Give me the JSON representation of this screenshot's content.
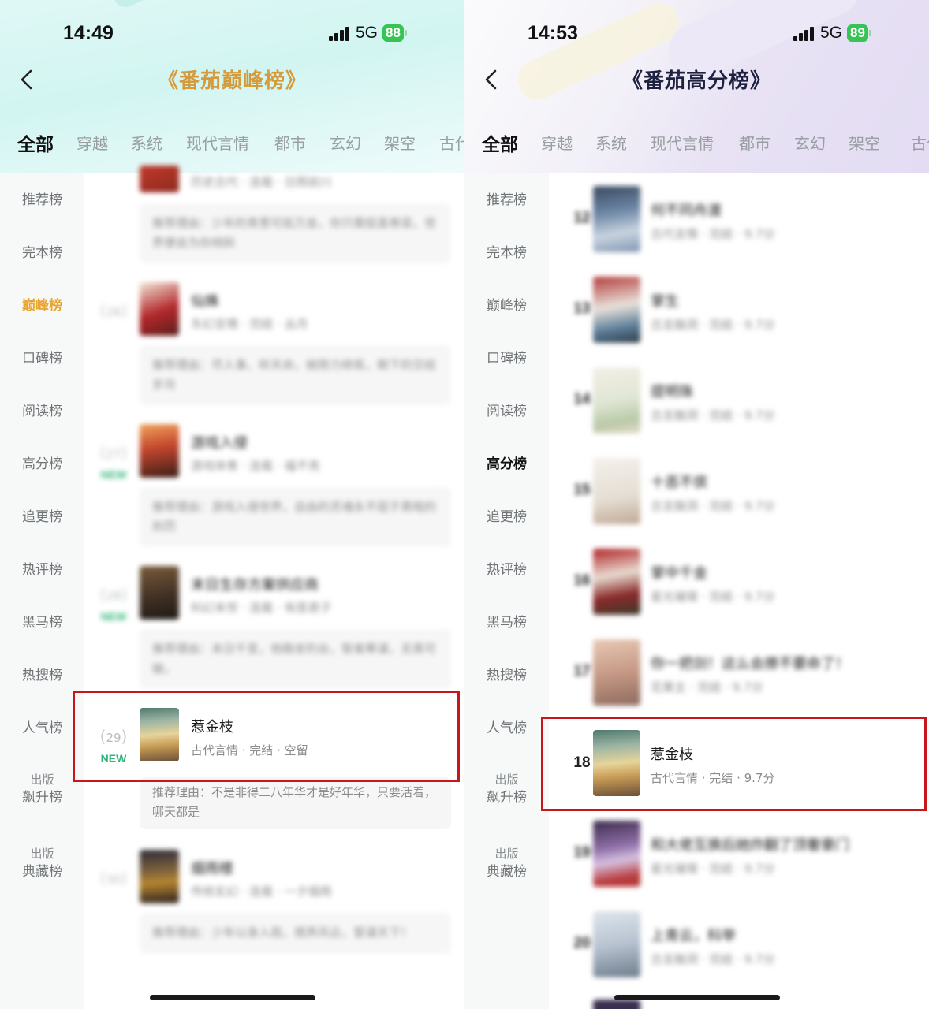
{
  "left": {
    "status": {
      "time": "14:49",
      "network": "5G",
      "battery": "88"
    },
    "nav": {
      "title": "《番茄巅峰榜》"
    },
    "tabs": [
      "全部",
      "穿越",
      "系统",
      "现代言情",
      "都市",
      "玄幻",
      "架空",
      "古代"
    ],
    "sidebar": [
      {
        "label": "推荐榜"
      },
      {
        "label": "完本榜"
      },
      {
        "label": "巅峰榜",
        "active": true
      },
      {
        "label": "口碑榜"
      },
      {
        "label": "阅读榜"
      },
      {
        "label": "高分榜"
      },
      {
        "label": "追更榜"
      },
      {
        "label": "热评榜"
      },
      {
        "label": "黑马榜"
      },
      {
        "label": "热搜榜"
      },
      {
        "label": "人气榜"
      },
      {
        "sub": "出版",
        "label": "飙升榜"
      },
      {
        "sub": "出版",
        "label": "典藏榜"
      }
    ],
    "books": [
      {
        "rank": "",
        "title": "",
        "meta": "历史古代 · 连载 · 日照前川",
        "reason": "推荐理由：少年的青葱可抵万金，你只需挺直脊梁，世界便会为你倾斜",
        "new": ""
      },
      {
        "rank": "26",
        "title": "仙姝",
        "meta": "东幻言情 · 完结 · 丛月",
        "reason": "推荐理由：尽人事、听天命，她努力修炼，剩下的交给岁月",
        "new": ""
      },
      {
        "rank": "27",
        "title": "游戏入侵",
        "meta": "游戏体育 · 连载 · 福不亮",
        "reason": "推荐理由：游戏入侵世界，自由的灵魂永不屈于黑暗的刑罚",
        "new": "NEW"
      },
      {
        "rank": "28",
        "title": "末日生存方案供应商",
        "meta": "科幻末世 · 连载 · 有匪君子",
        "reason": "推荐理由：末日千变，他稳坐钓台，智者筹谋，无畏可破。",
        "new": "NEW"
      },
      {
        "rank": "29",
        "title": "惹金枝",
        "meta": "古代言情 · 完结 · 空留",
        "reason": "推荐理由：不是非得二八年华才是好年华，只要活着，哪天都是",
        "new": "NEW"
      },
      {
        "rank": "30",
        "title": "烟雨楼",
        "meta": "传统玄幻 · 连载 · 一夕烟雨",
        "reason": "推荐理由：少年以身入局，搅弄风云，誓谋天下！",
        "new": ""
      }
    ]
  },
  "right": {
    "status": {
      "time": "14:53",
      "network": "5G",
      "battery": "89"
    },
    "nav": {
      "title": "《番茄高分榜》"
    },
    "tabs": [
      "全部",
      "穿越",
      "系统",
      "现代言情",
      "都市",
      "玄幻",
      "架空",
      "古代"
    ],
    "sidebar": [
      {
        "label": "推荐榜"
      },
      {
        "label": "完本榜"
      },
      {
        "label": "巅峰榜"
      },
      {
        "label": "口碑榜"
      },
      {
        "label": "阅读榜"
      },
      {
        "label": "高分榜",
        "active": true
      },
      {
        "label": "追更榜"
      },
      {
        "label": "热评榜"
      },
      {
        "label": "黑马榜"
      },
      {
        "label": "热搜榜"
      },
      {
        "label": "人气榜"
      },
      {
        "sub": "出版",
        "label": "飙升榜"
      },
      {
        "sub": "出版",
        "label": "典藏榜"
      }
    ],
    "books": [
      {
        "rank": "12",
        "title": "何不同舟渡",
        "meta": "古代言情 · 完结 · 9.7分"
      },
      {
        "rank": "13",
        "title": "掌生",
        "meta": "古言脑洞 · 完结 · 9.7分"
      },
      {
        "rank": "14",
        "title": "提明珠",
        "meta": "古言脑洞 · 完结 · 9.7分"
      },
      {
        "rank": "15",
        "title": "十恶不傧",
        "meta": "古言脑洞 · 完结 · 9.7分"
      },
      {
        "rank": "16",
        "title": "掌中千金",
        "meta": "星光璀璨 · 完结 · 9.7分"
      },
      {
        "rank": "17",
        "title": "你一把剑！这么会撩不要命了！",
        "meta": "花果主 · 完结 · 9.7分"
      },
      {
        "rank": "18",
        "title": "惹金枝",
        "meta": "古代言情 · 完结 · 9.7分"
      },
      {
        "rank": "19",
        "title": "和大佬互换后她炸翻了顶奢豪门",
        "meta": "星光璀璨 · 完结 · 9.7分"
      },
      {
        "rank": "20",
        "title": "上青云，科举",
        "meta": "古言脑洞 · 完结 · 9.7分"
      }
    ]
  },
  "colors": {
    "highlight": "#c8171b",
    "left_accent": "#e8a42c",
    "new_tag": "#31b57a",
    "battery": "#36c554"
  }
}
